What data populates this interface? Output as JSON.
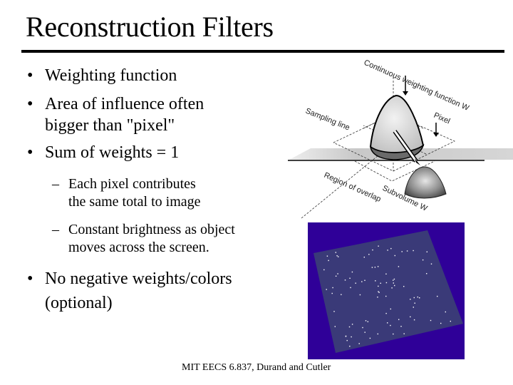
{
  "slide": {
    "title": "Reconstruction Filters",
    "bullets": [
      {
        "lines": [
          "Weighting function"
        ]
      },
      {
        "lines": [
          "Area of influence often",
          "bigger than \"pixel\""
        ]
      },
      {
        "lines": [
          "Sum of weights = 1"
        ]
      }
    ],
    "sub_bullets": [
      {
        "lines": [
          "Each pixel contributes",
          "the same total to image"
        ]
      },
      {
        "lines": [
          "Constant brightness as object",
          "moves across the screen."
        ]
      }
    ],
    "last_bullet": {
      "lines": [
        "No negative weights/colors",
        "(optional)"
      ]
    },
    "bullet_glyph": "•",
    "dash_glyph": "–",
    "footer": "MIT EECS 6.837, Durand and Cutler"
  },
  "diagram": {
    "labels": {
      "weighting_function": "Continuous weighting function W",
      "pixel": "Pixel",
      "sample_line": "Sampling line",
      "region_overlap": "Region of overlap",
      "subvolume": "Subvolume W"
    }
  },
  "render_image": {
    "background_color": "#2f0098",
    "plane_color": "#3a3a78",
    "dot_color": "#ffffff"
  }
}
